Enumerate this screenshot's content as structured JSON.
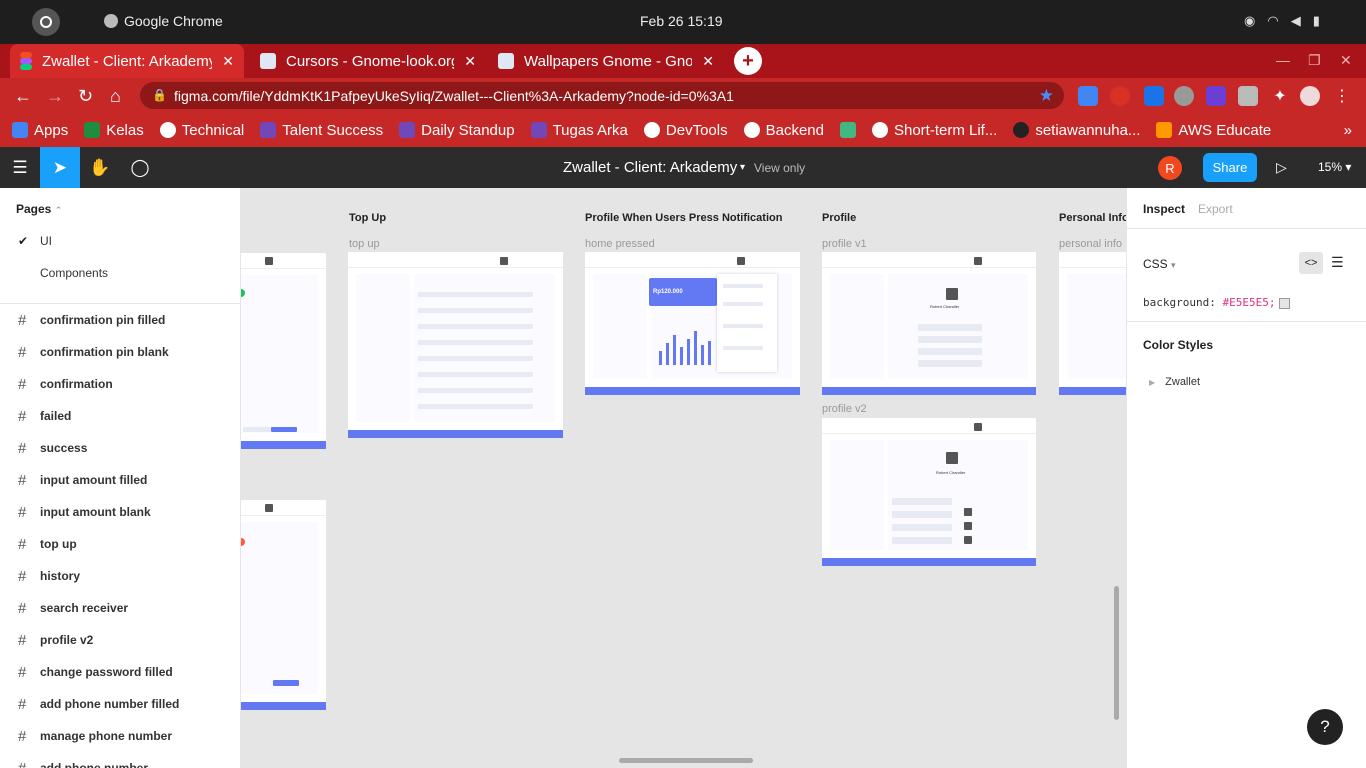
{
  "os": {
    "app_name": "Google Chrome",
    "clock": "Feb 26  15:19"
  },
  "tabs": [
    {
      "title": "Zwallet - Client: Arkademy"
    },
    {
      "title": "Cursors - Gnome-look.org"
    },
    {
      "title": "Wallpapers Gnome - Gnome-look.org"
    }
  ],
  "address": {
    "url": "figma.com/file/YddmKtK1PafpeyUkeSyIiq/Zwallet---Client%3A-Arkademy?node-id=0%3A1"
  },
  "bookmarks": [
    {
      "label": "Apps",
      "color": "#4285f4"
    },
    {
      "label": "Kelas",
      "color": "#1e8e3e"
    },
    {
      "label": "Technical",
      "color": "#ffffff"
    },
    {
      "label": "Talent Success",
      "color": "#7248b9"
    },
    {
      "label": "Daily Standup",
      "color": "#7248b9"
    },
    {
      "label": "Tugas Arka",
      "color": "#7248b9"
    },
    {
      "label": "DevTools",
      "color": "#ffffff"
    },
    {
      "label": "Backend",
      "color": "#ffffff"
    },
    {
      "label": "",
      "color": "#41b883"
    },
    {
      "label": "Short-term Lif...",
      "color": "#ffffff"
    },
    {
      "label": "setiawannuha...",
      "color": "#222222"
    },
    {
      "label": "AWS Educate",
      "color": "#ff9900"
    }
  ],
  "figma": {
    "file_title": "Zwallet - Client: Arkademy",
    "view_only": "View only",
    "avatar_initial": "R",
    "share_label": "Share",
    "zoom": "15%"
  },
  "left_panel": {
    "pages_header": "Pages",
    "pages": [
      {
        "label": "UI",
        "current": true
      },
      {
        "label": "Components",
        "current": false
      }
    ],
    "layers": [
      "confirmation pin filled",
      "confirmation pin blank",
      "confirmation",
      "failed",
      "success",
      "input amount filled",
      "input amount blank",
      "top up",
      "history",
      "search receiver",
      "profile v2",
      "change password filled",
      "add phone number filled",
      "manage phone number",
      "add phone number"
    ]
  },
  "canvas": {
    "background": "#E5E5E5",
    "accent": "#6379f4",
    "sections": [
      {
        "title": "Top Up",
        "frame": "top up"
      },
      {
        "title": "Profile When Users Press Notification",
        "frame": "home pressed",
        "balance": "Rp120.000"
      },
      {
        "title": "Profile",
        "frame": "profile v1",
        "frame2": "profile v2",
        "name": "Robert Chandler"
      },
      {
        "title": "Personal Info",
        "frame": "personal info"
      }
    ]
  },
  "right_panel": {
    "tab_inspect": "Inspect",
    "tab_export": "Export",
    "css_label": "CSS",
    "css_prop": "background:",
    "css_value": "#E5E5E5;",
    "color_styles": "Color Styles",
    "color_style_item": "Zwallet",
    "help": "?"
  }
}
